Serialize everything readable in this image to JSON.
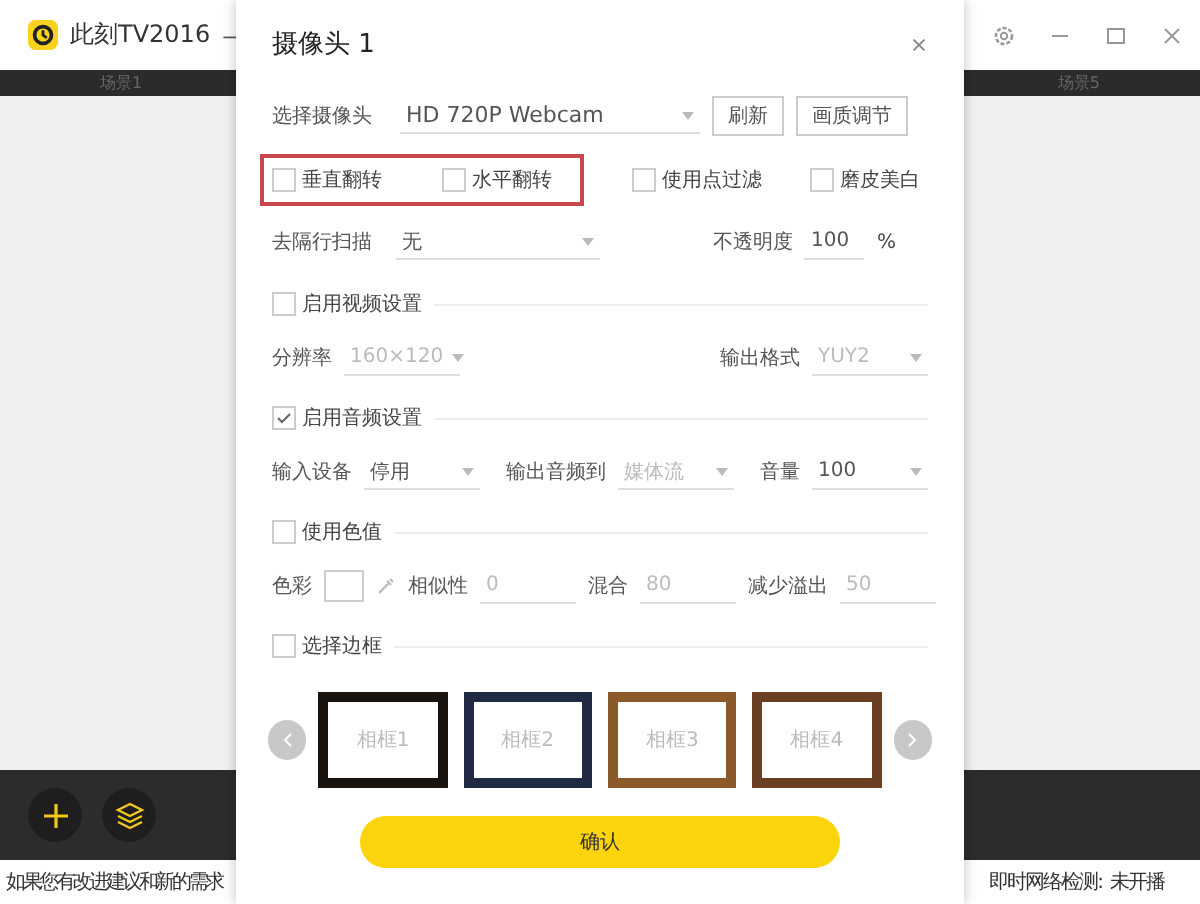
{
  "app": {
    "title": "此刻TV2016",
    "title_dash": "—",
    "scene_tabs": [
      "场景1",
      "场景5"
    ]
  },
  "status_bar": {
    "left": "如果您有改进建议和新的需求",
    "right_label": "即时网络检测:",
    "right_value": "未开播"
  },
  "dialog": {
    "title": "摄像头 1",
    "camera": {
      "label": "选择摄像头",
      "value": "HD 720P Webcam",
      "buttons": [
        "刷新",
        "画质调节"
      ]
    },
    "highlighted_options": [
      {
        "label": "垂直翻转",
        "checked": false
      },
      {
        "label": "水平翻转",
        "checked": false
      }
    ],
    "options": [
      {
        "label": "使用点过滤",
        "checked": false
      },
      {
        "label": "磨皮美白",
        "checked": false
      }
    ],
    "deinterlace": {
      "label": "去隔行扫描",
      "value": "无"
    },
    "opacity": {
      "label": "不透明度",
      "value": "100",
      "unit": "%"
    },
    "sections": [
      {
        "label": "启用视频设置",
        "checked": false,
        "fields": [
          {
            "kind": "select",
            "label": "分辨率",
            "value": "160×120",
            "disabled": true
          },
          {
            "kind": "select",
            "label": "输出格式",
            "value": "YUY2",
            "disabled": true
          }
        ]
      },
      {
        "label": "启用音频设置",
        "checked": true,
        "fields": [
          {
            "kind": "select",
            "label": "输入设备",
            "value": "停用",
            "disabled": false
          },
          {
            "kind": "select",
            "label": "输出音频到",
            "value": "媒体流",
            "disabled": true
          },
          {
            "kind": "select",
            "label": "音量",
            "value": "100",
            "disabled": false
          }
        ]
      },
      {
        "label": "使用色值",
        "checked": false,
        "fields": [
          {
            "kind": "color",
            "label": "色彩"
          },
          {
            "kind": "input",
            "label": "相似性",
            "value": "0",
            "disabled": true
          },
          {
            "kind": "input",
            "label": "混合",
            "value": "80",
            "disabled": true
          },
          {
            "kind": "input",
            "label": "减少溢出",
            "value": "50",
            "disabled": true
          }
        ]
      },
      {
        "label": "选择边框",
        "checked": false
      }
    ],
    "frames": [
      {
        "label": "相框1",
        "color": "#1a1410"
      },
      {
        "label": "相框2",
        "color": "#1f2a44"
      },
      {
        "label": "相框3",
        "color": "#8a5a2b"
      },
      {
        "label": "相框4",
        "color": "#6b3f22"
      }
    ],
    "confirm": "确认"
  }
}
